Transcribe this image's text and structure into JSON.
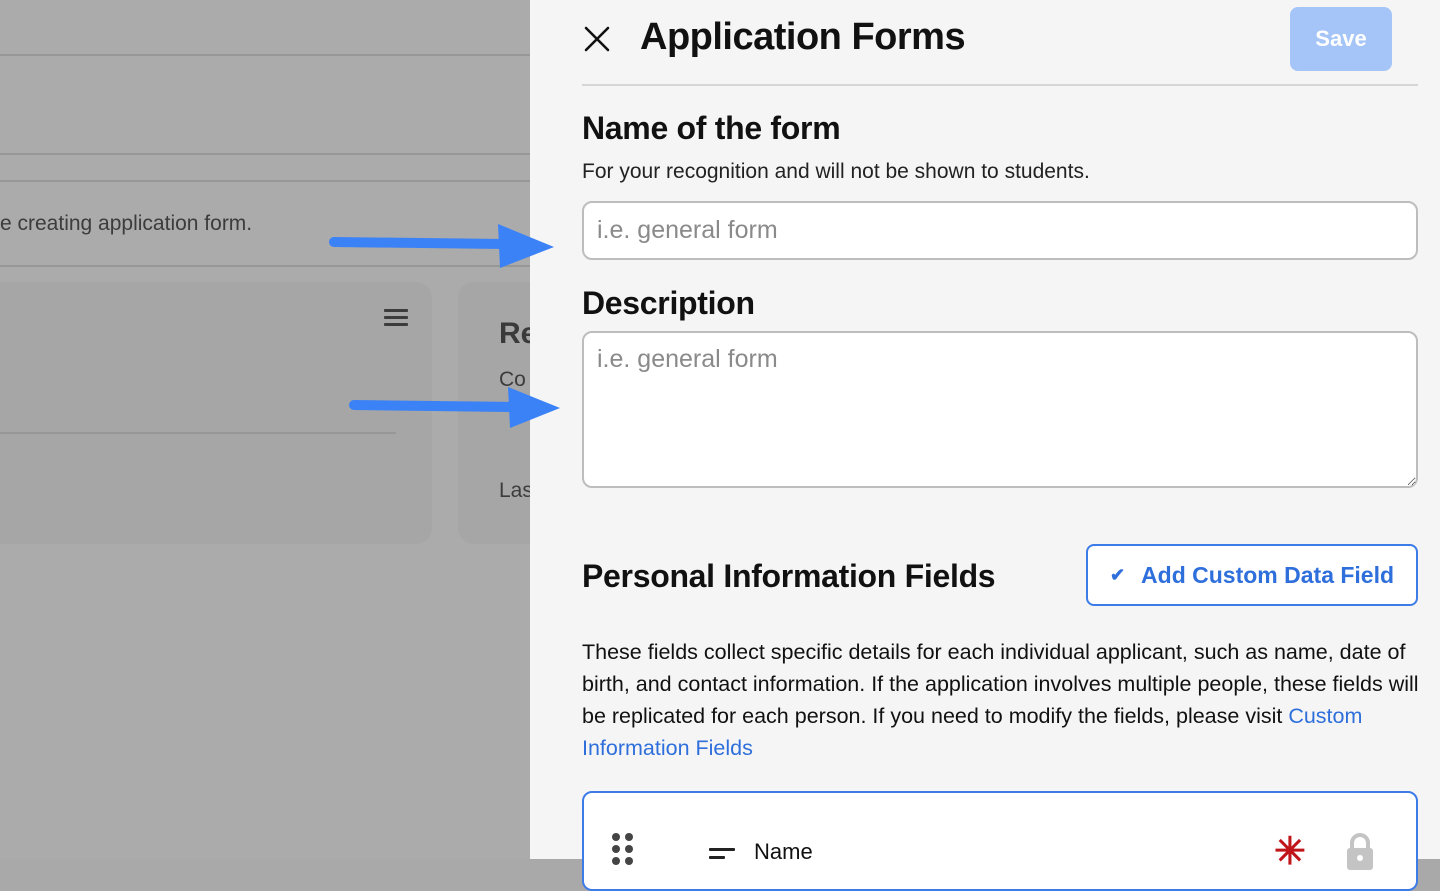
{
  "background": {
    "hint_text": "e creating application form.",
    "card_heading": "Re",
    "card_subtext": "Co",
    "card_footer": "Las"
  },
  "panel": {
    "title": "Application Forms",
    "save_label": "Save",
    "name_section": {
      "heading": "Name of the form",
      "helper": "For your recognition and will not be shown to students.",
      "placeholder": "i.e. general form",
      "value": ""
    },
    "description_section": {
      "heading": "Description",
      "placeholder": "i.e. general form",
      "value": ""
    },
    "personal_info": {
      "heading": "Personal Information Fields",
      "add_button_label": "Add Custom Data Field",
      "description": "These fields collect specific details for each individual applicant, such as name, date of birth, and contact information. If the application involves multiple people, these fields will be replicated for each person. If you need to modify the fields, please visit ",
      "link_text": "Custom Information Fields",
      "fields": [
        {
          "label": "Name",
          "required": true,
          "locked": true
        }
      ]
    }
  },
  "colors": {
    "accent": "#2f6fdc",
    "save_disabled": "#a5c4f7",
    "annotation_arrow": "#3b82f6",
    "required": "#c0151a"
  },
  "icons": [
    "close-icon",
    "check-icon",
    "drag-handle-icon",
    "short-text-icon",
    "required-asterisk-icon",
    "lock-icon",
    "hamburger-menu-icon",
    "arrow-icon"
  ]
}
